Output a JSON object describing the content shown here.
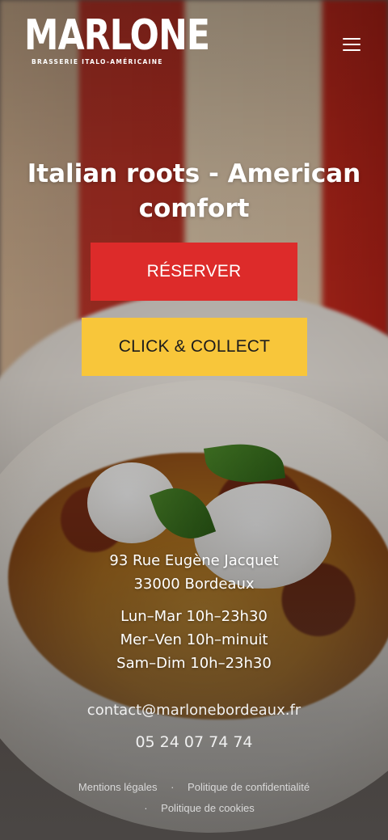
{
  "brand": {
    "name": "MARLONE",
    "tagline": "BRASSERIE ITALO-AMÉRICAINE"
  },
  "nav": {
    "menu_icon": "hamburger-menu-icon"
  },
  "hero": {
    "headline_line1": "Italian roots - American",
    "headline_line2": "comfort",
    "reserve_label": "RÉSERVER",
    "click_collect_label": "CLICK & COLLECT"
  },
  "info": {
    "address_line1": "93 Rue Eugène Jacquet",
    "address_line2": "33000 Bordeaux",
    "hours": [
      "Lun–Mar 10h–23h30",
      "Mer–Ven 10h–minuit",
      "Sam–Dim 10h–23h30"
    ],
    "email": "contact@marlonebordeaux.fr",
    "phone": "05 24 07 74 74"
  },
  "footer": {
    "links": [
      "Mentions légales",
      "Politique de confidentialité",
      "Politique de cookies"
    ],
    "separator": "·"
  },
  "colors": {
    "reserve_button": "#dd2b2a",
    "click_collect_button": "#f8c63a"
  }
}
